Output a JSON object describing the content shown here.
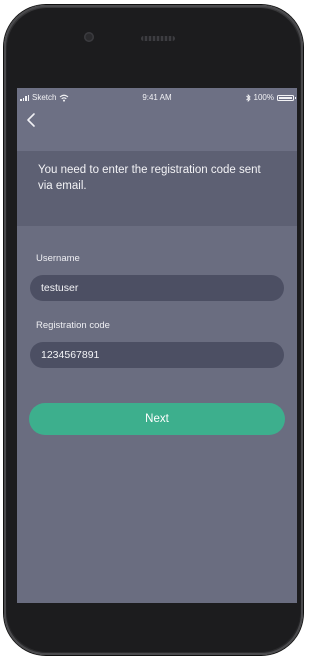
{
  "status_bar": {
    "carrier": "Sketch",
    "time": "9:41 AM",
    "battery": "100%",
    "battery_level": 1.0,
    "icons": [
      "signal-icon",
      "wifi-icon",
      "bluetooth-icon",
      "battery-icon"
    ]
  },
  "nav": {
    "back_icon": "chevron-left-icon"
  },
  "info": {
    "message": "You need to enter the registration code sent via email."
  },
  "form": {
    "username_label": "Username",
    "username_value": "testuser",
    "code_label": "Registration code",
    "code_value": "1234567891",
    "next_label": "Next"
  },
  "colors": {
    "accent": "#3daf8d",
    "background": "#6a6d80",
    "panel": "#5d6073",
    "field": "#4c4f63",
    "device": "#1e1e20"
  }
}
